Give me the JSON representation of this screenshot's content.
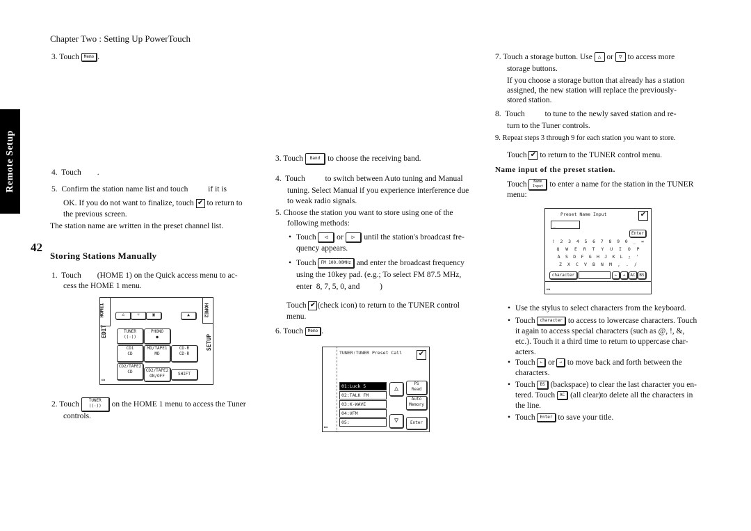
{
  "header": {
    "chapter": "Chapter Two : Setting Up PowerTouch"
  },
  "side_tab": {
    "label": "Remote Setup"
  },
  "page_number": "42",
  "col1": {
    "step3": {
      "prefix": "3.  Touch",
      "button": "Memo",
      "suffix": "."
    },
    "step4": {
      "text": "4.  Touch        ."
    },
    "step5": {
      "line1": "5.  Confirm the station name list and touch          if it is",
      "line2a": "OK. If you do not want to finalize, touch",
      "line2b": "to return to",
      "line3": "the previous screen."
    },
    "note": "The station name are written in the preset channel list.",
    "section_title": "Storing Stations Manually",
    "m_step1": {
      "line1": "1.  Touch        (HOME 1) on the Quick access menu to ac-",
      "line2": "cess the HOME 1 menu."
    },
    "m_step2": {
      "prefix": "2.  Touch",
      "button_label": "TUNER",
      "line1": "on the HOME 1 menu to access the Tuner",
      "line2": "controls."
    }
  },
  "home1_screen": {
    "left_tab_top": "HOME1",
    "left_tab_bottom": "EDIT",
    "right_tab_top": "HOME2",
    "right_tab_bottom": "SETUP",
    "top_icons": [
      "home-icon",
      "light-icon",
      "tv-icon",
      "eject-icon"
    ],
    "buttons": [
      {
        "label": "TUNER",
        "sub": "((·))"
      },
      {
        "label": "PHONO",
        "sub": "●"
      },
      {
        "label": "CD1",
        "sub": "CD"
      },
      {
        "label": "MD/TAPE1",
        "sub": "MD"
      },
      {
        "label": "CD-R",
        "sub": "CD-R"
      },
      {
        "label": "CD2/TAPE2",
        "sub": "CD"
      },
      {
        "label": "CD2/TAPE2",
        "sub": "ON/OFF"
      },
      {
        "label": "SHIFT",
        "sub": ""
      }
    ]
  },
  "col2": {
    "step3": {
      "prefix": "3.  Touch",
      "button": "Band",
      "suffix": "to choose the receiving band."
    },
    "step4": {
      "line1": "4.  Touch          to switch between Auto tuning and Manual",
      "line2": "tuning. Select Manual if you experience interference due",
      "line3": "to weak radio signals."
    },
    "step5": {
      "line1": "5.  Choose the station you want to store using one of the",
      "line2": "following methods:"
    },
    "bullet1": {
      "prefix": "Touch",
      "btn_left": "◁",
      "or": "or",
      "btn_right": "▷",
      "suffix": "until the station's broadcast fre-",
      "line2": "quency appears."
    },
    "bullet2": {
      "prefix": "Touch",
      "button": "FM 100.00MHz",
      "suffix": "and enter the broadcast frequency",
      "line2": "using the 10key pad. (e.g.; To select FM 87.5 MHz,",
      "line3": "enter  8, 7, 5, 0, and          )"
    },
    "check_note": {
      "prefix": "Touch",
      "suffix": "(check icon) to return to the TUNER control",
      "line2": "menu."
    },
    "step6": {
      "prefix": "6.  Touch",
      "button": "Memo",
      "suffix": "."
    }
  },
  "preset_screen": {
    "title": "TUNER:TUNER Preset Call",
    "rows": [
      "01:Luck 5",
      "02:TALK FM",
      "03:K-WAVE",
      "04:VFM",
      "05:"
    ],
    "selected_index": 0,
    "up": "△",
    "down": "▽",
    "btn_ps_read": [
      "PS",
      "Read"
    ],
    "btn_auto_memory": [
      "Auto",
      "Memory"
    ],
    "btn_enter": "Enter"
  },
  "col3": {
    "step7": {
      "prefix": "7.  Touch a storage button. Use",
      "up": "△",
      "or": "or",
      "down": "▽",
      "suffix": "to access more",
      "line2": "storage buttons."
    },
    "step7_note": {
      "line1": "If you choose a storage button that already has a station",
      "line2": "assigned, the new station will replace the previously-",
      "line3": "stored station."
    },
    "step8": {
      "line1": "8.  Touch          to tune to the newly saved station and re-",
      "line2": "turn to the Tuner controls."
    },
    "step9": "9.  Repeat steps 3 through 9 for each station you want to store.",
    "return_note": {
      "prefix": "Touch",
      "suffix": "to return to the TUNER control menu."
    },
    "name_heading": "Name input of the preset station.",
    "name_intro": {
      "prefix": "Touch",
      "button": "Name Input",
      "suffix": "to enter a name for the station in the TUNER",
      "line2": "menu:"
    },
    "bullets": [
      {
        "line1": "Use the stylus to select characters from the keyboard."
      },
      {
        "prefix": "Touch",
        "button": "character",
        "suffix": "to access to lowercase characters. Touch",
        "line2": "it again to access special characters (such as @, !, &,",
        "line3": "etc.). Touch it a third time to return to uppercase char-",
        "line4": "acters."
      },
      {
        "prefix": "Touch",
        "btn_a": "←",
        "or": "or",
        "btn_b": "→",
        "suffix": "to move back and forth between the",
        "line2": "characters."
      },
      {
        "prefix": "Touch",
        "button": "BS",
        "suffix": "(backspace) to clear the last character you en-",
        "line2a": "tered. Touch",
        "button2": "AC",
        "line2b": "(all clear)to delete all the characters in",
        "line3": "the line."
      },
      {
        "prefix": "Touch",
        "button": "Enter",
        "suffix": "to save your title."
      }
    ]
  },
  "name_screen": {
    "title": "Preset Name Input",
    "input_value": "_",
    "enter": "Enter",
    "rows": [
      [
        "!",
        "2",
        "3",
        "4",
        "5",
        "6",
        "7",
        "8",
        "9",
        "0",
        "_",
        "="
      ],
      [
        "Q",
        "W",
        "E",
        "R",
        "T",
        "Y",
        "U",
        "I",
        "O",
        "P"
      ],
      [
        "A",
        "S",
        "D",
        "F",
        "G",
        "H",
        "J",
        "K",
        "L",
        ";",
        "'"
      ],
      [
        "Z",
        "X",
        "C",
        "V",
        "B",
        "N",
        "M",
        ",",
        ".",
        "/"
      ]
    ],
    "character_btn": "character",
    "left": "←",
    "right": "→",
    "ac": "AC",
    "bs": "BS"
  }
}
